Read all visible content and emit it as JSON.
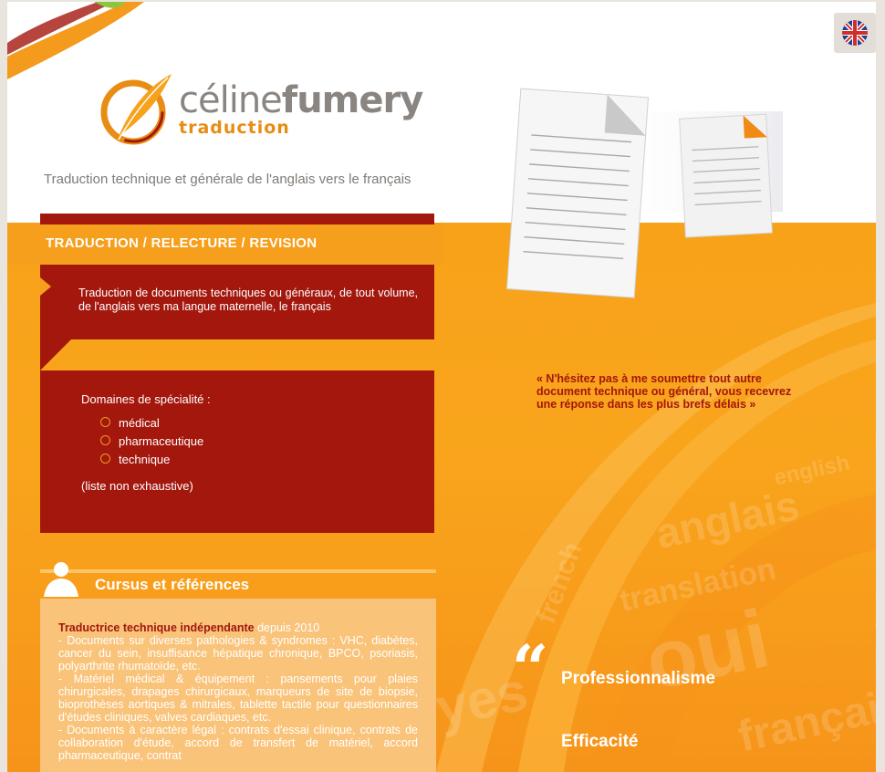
{
  "brand": {
    "name_light": "céline",
    "name_bold": "fumery",
    "subtitle": "traduction",
    "tagline": "Traduction technique et générale de l'anglais vers le français"
  },
  "language_switch": {
    "icon": "uk-flag-icon"
  },
  "services": {
    "header": "TRADUCTION / RELECTURE / REVISION",
    "description": "Traduction de documents techniques ou généraux, de tout volume, de l'anglais vers ma langue maternelle, le français",
    "specialties_title": "Domaines de spécialité :",
    "specialties": [
      "médical",
      "pharmaceutique",
      "technique"
    ],
    "specialties_note": "(liste non exhaustive)"
  },
  "cursus": {
    "title": "Cursus et références",
    "role": "Traductrice technique indépendante",
    "since": "depuis 2010",
    "items": [
      "- Documents sur diverses pathologies & syndromes : VHC, diabètes, cancer du sein, insuffisance hépatique chronique, BPCO, psoriasis, polyarthrite rhumatoïde, etc.",
      "- Matériel médical & équipement : pansements pour plaies chirurgicales, drapages chirurgicaux, marqueurs de site de biopsie, bioprothèses aortiques & mitrales, tablette tactile pour questionnaires d'études cliniques, valves cardiaques, etc.",
      "- Documents à caractère légal : contrats d'essai clinique, contrats de collaboration d'étude, accord de transfert de matériel, accord pharmaceutique, contrat"
    ]
  },
  "promo": {
    "quote": "« N'hésitez pas à me soumettre tout autre document technique ou général, vous recevrez une réponse dans les plus brefs délais »",
    "quote_mark": "“",
    "value_1": "Professionnalisme",
    "value_2": "Efficacité"
  },
  "colors": {
    "accent_orange": "#f8a21a",
    "dark_red": "#a3170d",
    "gray_text": "#8a8580"
  }
}
